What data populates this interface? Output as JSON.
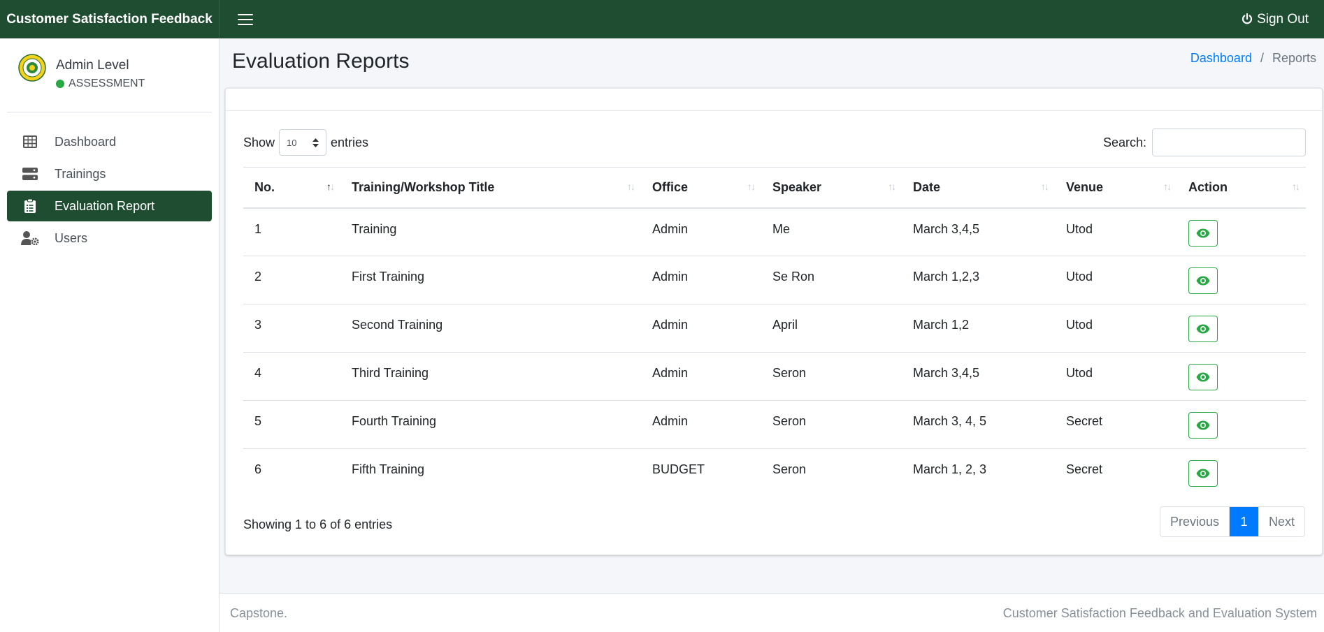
{
  "topbar": {
    "brand": "Customer Satisfaction Feedback",
    "sign_out": "Sign Out"
  },
  "sidebar": {
    "user_name": "Admin Level",
    "user_status": "ASSESSMENT",
    "items": [
      {
        "label": "Dashboard",
        "icon": "table-icon"
      },
      {
        "label": "Trainings",
        "icon": "server-icon"
      },
      {
        "label": "Evaluation Report",
        "icon": "clipboard-list-icon",
        "active": true
      },
      {
        "label": "Users",
        "icon": "user-gear-icon"
      }
    ]
  },
  "header": {
    "title": "Evaluation Reports",
    "breadcrumb": [
      "Dashboard",
      "Reports"
    ]
  },
  "table_controls": {
    "show_label": "Show",
    "entries_value": "10",
    "entries_label": "entries",
    "search_label": "Search:",
    "search_value": ""
  },
  "table": {
    "columns": [
      "No.",
      "Training/Workshop Title",
      "Office",
      "Speaker",
      "Date",
      "Venue",
      "Action"
    ],
    "rows": [
      [
        "1",
        "Training",
        "Admin",
        "Me",
        "March 3,4,5",
        "Utod"
      ],
      [
        "2",
        "First Training",
        "Admin",
        "Se Ron",
        "March 1,2,3",
        "Utod"
      ],
      [
        "3",
        "Second Training",
        "Admin",
        "April",
        "March 1,2",
        "Utod"
      ],
      [
        "4",
        "Third Training",
        "Admin",
        "Seron",
        "March 3,4,5",
        "Utod"
      ],
      [
        "5",
        "Fourth Training",
        "Admin",
        "Seron",
        "March 3, 4, 5",
        "Secret"
      ],
      [
        "6",
        "Fifth Training",
        "BUDGET",
        "Seron",
        "March 1, 2, 3",
        "Secret"
      ]
    ]
  },
  "table_footer": {
    "info": "Showing 1 to 6 of 6 entries",
    "previous": "Previous",
    "page": "1",
    "next": "Next"
  },
  "footer": {
    "left": "Capstone.",
    "right": "Customer Satisfaction Feedback and Evaluation System"
  },
  "colors": {
    "brand_green": "#1f4d32",
    "accent_blue": "#007bff",
    "status_green": "#28a745"
  }
}
